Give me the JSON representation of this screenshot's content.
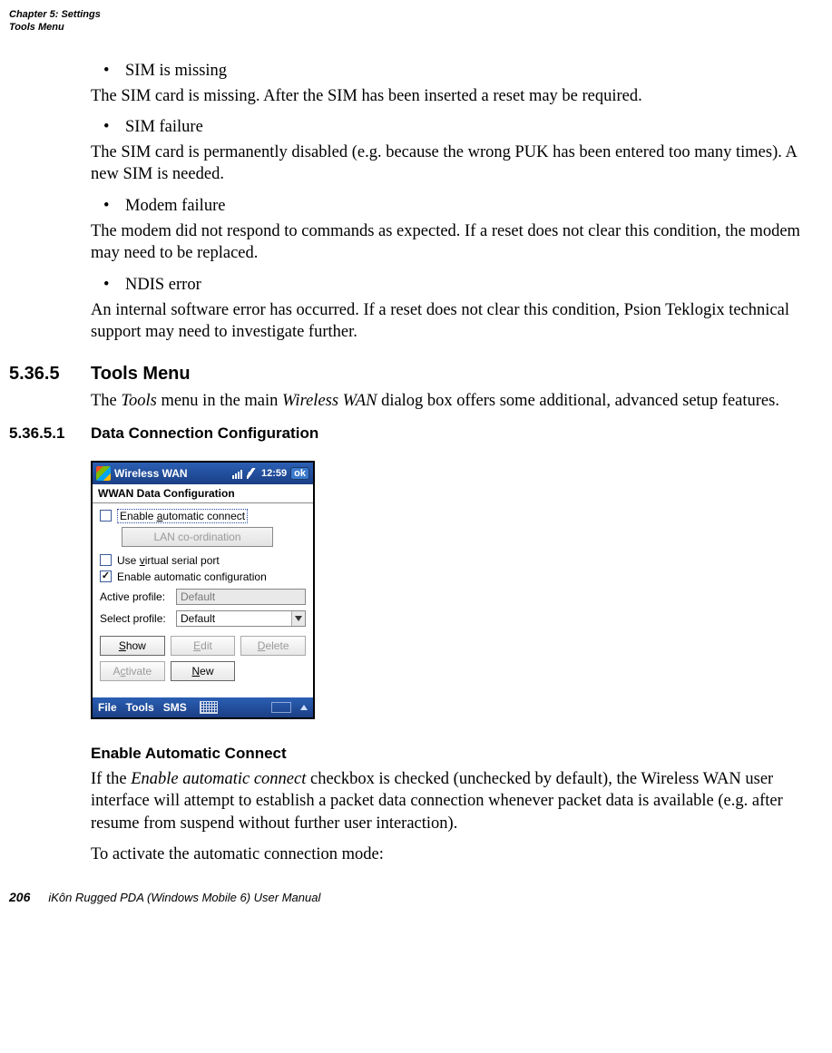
{
  "header": {
    "chapter": "Chapter 5:  Settings",
    "section": "Tools Menu"
  },
  "bullets": {
    "b1": "SIM is missing",
    "b2": "SIM failure",
    "b3": "Modem failure",
    "b4": "NDIS error"
  },
  "paras": {
    "p1": "The SIM card is missing. After the SIM has been inserted a reset may be required.",
    "p2": "The SIM card is permanently disabled (e.g. because the wrong PUK has been entered too many times). A new SIM is needed.",
    "p3": "The modem did not respond to commands as expected. If a reset does not clear this condi­tion, the modem may need to be replaced.",
    "p4": "An internal software error has occurred. If a reset does not clear this condition, Psion Tek­logix technical support may need to investigate further."
  },
  "h2": {
    "num": "5.36.5",
    "title": "Tools Menu"
  },
  "h2para": {
    "pre": "The ",
    "em1": "Tools",
    "mid": " menu in the main ",
    "em2": "Wireless WAN",
    "post": " dialog box offers some additional, advanced setup features."
  },
  "h3": {
    "num": "5.36.5.1",
    "title": "Data Connection Configuration"
  },
  "screenshot": {
    "title": "Wireless WAN",
    "time": "12:59",
    "ok": "ok",
    "heading": "WWAN Data Configuration",
    "chk_auto_connect": {
      "pre": "Enable ",
      "u": "a",
      "post": "utomatic connect"
    },
    "lan_btn": "LAN co-ordination",
    "chk_vsp": {
      "pre": "Use ",
      "u": "v",
      "post": "irtual serial port"
    },
    "chk_auto_cfg": "Enable automatic configuration",
    "active_label": "Active profile:",
    "active_value": "Default",
    "select_label": "Select profile:",
    "select_value": "Default",
    "btn_show": {
      "u": "S",
      "post": "how"
    },
    "btn_edit": {
      "u": "E",
      "post": "dit"
    },
    "btn_delete": {
      "u": "D",
      "post": "elete"
    },
    "btn_activate": {
      "pre": "A",
      "u": "c",
      "post": "tivate"
    },
    "btn_new": {
      "u": "N",
      "post": "ew"
    },
    "menu": {
      "file": "File",
      "tools": "Tools",
      "sms": "SMS"
    }
  },
  "h4": "Enable Automatic Connect",
  "h4para": {
    "pre": "If the ",
    "em": "Enable automatic connect",
    "post": " checkbox is checked (unchecked by default), the Wireless WAN user interface will attempt to establish a packet data connection whenever packet data is available (e.g. after resume from suspend without further user interaction)."
  },
  "p_last": "To activate the automatic connection mode:",
  "footer": {
    "page": "206",
    "title": "iKôn Rugged PDA (Windows Mobile 6) User Manual"
  }
}
